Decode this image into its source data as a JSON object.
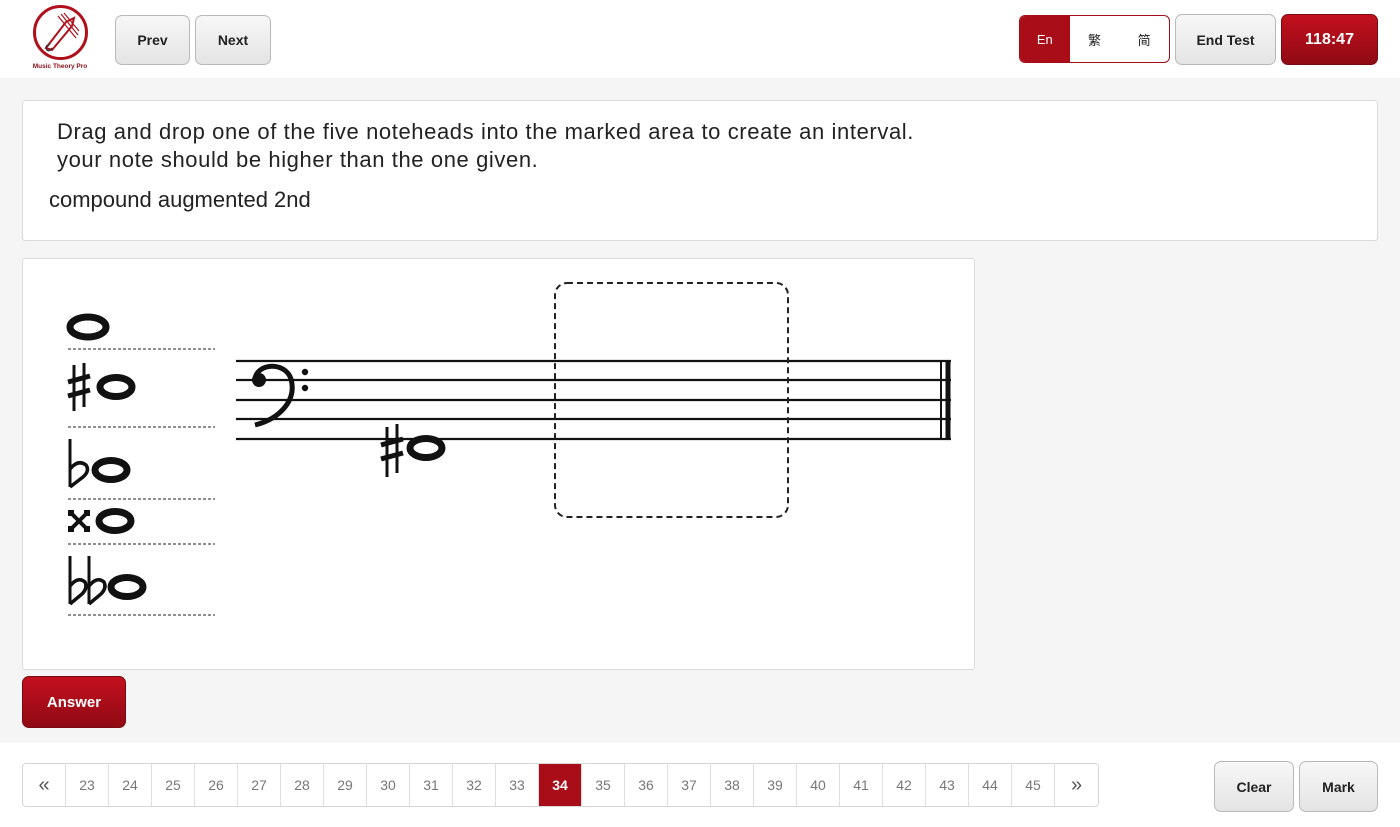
{
  "app": {
    "logo_text": "Music Theory Pro"
  },
  "toolbar": {
    "prev_label": "Prev",
    "next_label": "Next",
    "languages": [
      "En",
      "繁",
      "简"
    ],
    "active_language": "En",
    "end_test_label": "End Test",
    "timer": "118:47"
  },
  "question": {
    "instruction_line1": "Drag and drop one of the five noteheads into the marked area to create an interval.",
    "instruction_line2": "your note should be higher than the one given.",
    "interval": "compound augmented 2nd"
  },
  "exercise": {
    "clef": "bass",
    "given_note": {
      "accidental": "sharp",
      "glyph": "♯"
    },
    "note_palette": [
      {
        "accidental": "natural",
        "glyph": ""
      },
      {
        "accidental": "sharp",
        "glyph": "♯"
      },
      {
        "accidental": "flat",
        "glyph": "♭"
      },
      {
        "accidental": "double-sharp",
        "glyph": "x"
      },
      {
        "accidental": "double-flat",
        "glyph": "♭♭"
      }
    ]
  },
  "answer_label": "Answer",
  "pagination": {
    "prev_label": "«",
    "next_label": "»",
    "pages": [
      "23",
      "24",
      "25",
      "26",
      "27",
      "28",
      "29",
      "30",
      "31",
      "32",
      "33",
      "34",
      "35",
      "36",
      "37",
      "38",
      "39",
      "40",
      "41",
      "42",
      "43",
      "44",
      "45"
    ],
    "current": "34"
  },
  "footer": {
    "clear_label": "Clear",
    "mark_label": "Mark"
  },
  "colors": {
    "accent": "#a80d18",
    "accent_dark": "#8f0a14"
  }
}
